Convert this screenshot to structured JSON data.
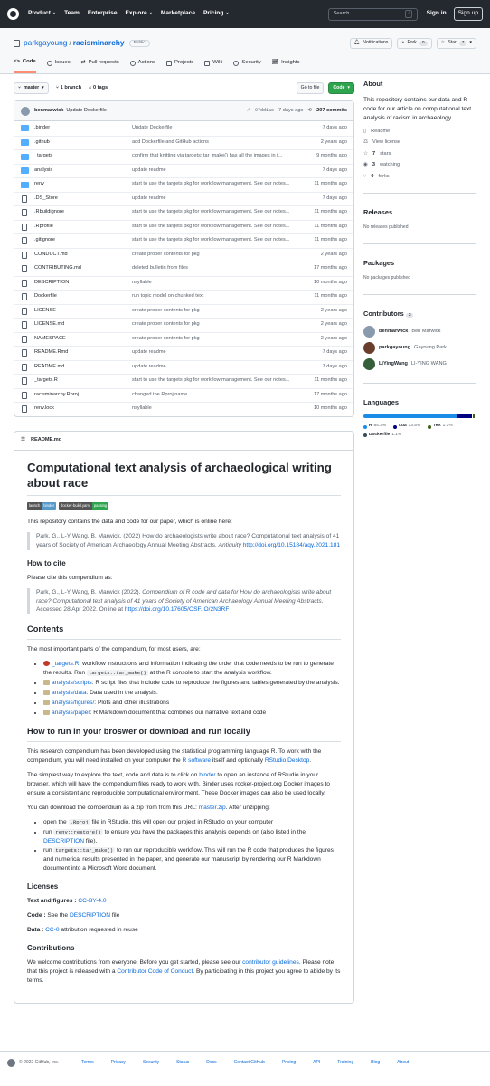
{
  "header": {
    "nav": [
      "Product",
      "Team",
      "Enterprise",
      "Explore",
      "Marketplace",
      "Pricing"
    ],
    "search_placeholder": "Search",
    "search_key": "/",
    "signin": "Sign in",
    "signup": "Sign up"
  },
  "repo": {
    "owner": "parkgayoung",
    "name": "racisminarchy",
    "visibility": "Public",
    "notifications": "Notifications",
    "fork": "Fork",
    "fork_count": "0",
    "star": "Star",
    "star_count": "7"
  },
  "tabs": [
    "Code",
    "Issues",
    "Pull requests",
    "Actions",
    "Projects",
    "Wiki",
    "Security",
    "Insights"
  ],
  "toolbar": {
    "branch": "master",
    "branches": "1 branch",
    "tags": "0 tags",
    "goto": "Go to file",
    "code": "Code"
  },
  "commit": {
    "user": "benmarwick",
    "message": "Update Dockerfile",
    "sha": "97dd1ae",
    "time": "7 days ago",
    "count": "207 commits"
  },
  "files": [
    {
      "type": "dir",
      "name": ".binder",
      "msg": "Update Dockerfile",
      "time": "7 days ago"
    },
    {
      "type": "dir",
      "name": ".github",
      "msg": "add Dockerfile and GitHub actions",
      "time": "2 years ago"
    },
    {
      "type": "dir",
      "name": "_targets",
      "msg": "confirm that knitting via targets::tar_make() has all the images in t...",
      "time": "9 months ago"
    },
    {
      "type": "dir",
      "name": "analysis",
      "msg": "update readme",
      "time": "7 days ago"
    },
    {
      "type": "dir",
      "name": "renv",
      "msg": "start to use the targets pkg for workflow management. See our notes...",
      "time": "11 months ago"
    },
    {
      "type": "file",
      "name": ".DS_Store",
      "msg": "update readme",
      "time": "7 days ago"
    },
    {
      "type": "file",
      "name": ".Rbuildignore",
      "msg": "start to use the targets pkg for workflow management. See our notes...",
      "time": "11 months ago"
    },
    {
      "type": "file",
      "name": ".Rprofile",
      "msg": "start to use the targets pkg for workflow management. See our notes...",
      "time": "11 months ago"
    },
    {
      "type": "file",
      "name": ".gitignore",
      "msg": "start to use the targets pkg for workflow management. See our notes...",
      "time": "11 months ago"
    },
    {
      "type": "file",
      "name": "CONDUCT.md",
      "msg": "create proper contents for pkg",
      "time": "2 years ago"
    },
    {
      "type": "file",
      "name": "CONTRIBUTING.md",
      "msg": "deleted bulletin from files",
      "time": "17 months ago"
    },
    {
      "type": "file",
      "name": "DESCRIPTION",
      "msg": "nsyllable",
      "time": "10 months ago"
    },
    {
      "type": "file",
      "name": "Dockerfile",
      "msg": "run topic model on chunked text",
      "time": "11 months ago"
    },
    {
      "type": "file",
      "name": "LICENSE",
      "msg": "create proper contents for pkg",
      "time": "2 years ago"
    },
    {
      "type": "file",
      "name": "LICENSE.md",
      "msg": "create proper contents for pkg",
      "time": "2 years ago"
    },
    {
      "type": "file",
      "name": "NAMESPACE",
      "msg": "create proper contents for pkg",
      "time": "2 years ago"
    },
    {
      "type": "file",
      "name": "README.Rmd",
      "msg": "update readme",
      "time": "7 days ago"
    },
    {
      "type": "file",
      "name": "README.md",
      "msg": "update readme",
      "time": "7 days ago"
    },
    {
      "type": "file",
      "name": "_targets.R",
      "msg": "start to use the targets pkg for workflow management. See our notes...",
      "time": "11 months ago"
    },
    {
      "type": "file",
      "name": "racisminarchy.Rproj",
      "msg": "changed the Rproj name",
      "time": "17 months ago"
    },
    {
      "type": "file",
      "name": "renv.lock",
      "msg": "nsyllable",
      "time": "10 months ago"
    }
  ],
  "readme": {
    "label": "README.md",
    "title": "Computational text analysis of archaeological writing about race",
    "badges": [
      {
        "left": "launch",
        "right": "binder",
        "color": "#579aca"
      },
      {
        "left": "docker-build.yaml",
        "right": "passing",
        "color": "#2ea44f"
      }
    ],
    "intro": "This repository contains the data and code for our paper, which is online here:",
    "quote1": "Park, G., L-Y Wang, B. Marwick, (2022) How do archaeologists write about race? Computational text analysis of 41 years of Society of American Archaeology Annual Meeting Abstracts.",
    "quote1_journal": "Antiquity",
    "quote1_link": "http://doi.org/10.15184/aqy.2021.181",
    "h_cite": "How to cite",
    "cite_intro": "Please cite this compendium as:",
    "quote2_a": "Park, G., L-Y Wang, B. Marwick (2022).",
    "quote2_b": "Compendium of R code and data for How do archaeologists write about race? Computational text analysis of 41 years of Society of American Archaeology Annual Meeting Abstracts",
    "quote2_c": ". Accessed 28 Apr 2022. Online at",
    "quote2_link": "https://doi.org/10.17605/OSF.IO/2N3RF",
    "h_contents": "Contents",
    "contents_intro": "The most important parts of the compendium, for most users, are:",
    "c1_link": "_targets.R",
    "c1_text": ": workflow instructions and information indicating the order that code needs to be run to generate the results. Run",
    "c1_code": "targets::tar_make()",
    "c1_tail": "at the R console to start the analysis workflow.",
    "c2_link": "analysis/scripts",
    "c2_text": ": R script files that include code to reproduce the figures and tables generated by the analysis.",
    "c3_link": "analysis/data",
    "c3_text": ": Data used in the analysis.",
    "c4_link": "analysis/figures/",
    "c4_text": ": Plots and other illustrations",
    "c5_link": "analysis/paper",
    "c5_text": ": R Markdown document that combines our narrative text and code",
    "h_run": "How to run in your broswer or download and run locally",
    "run1_a": "This research compendium has been developed using the statistical programming language R. To work with the compendium, you will need installed on your computer the",
    "run1_link1": "R software",
    "run1_b": "itself and optionally",
    "run1_link2": "RStudio Desktop",
    "run1_c": ".",
    "run2_a": "The simplest way to explore the text, code and data is to click on",
    "run2_link": "binder",
    "run2_b": "to open an instance of RStudio in your browser, which will have the compendium files ready to work with. Binder uses rocker-project.org Docker images to ensure a consistent and reproducible computational environment. These Docker images can also be used locally.",
    "run3_a": "You can download the compendium as a zip from from this URL:",
    "run3_link": "master.zip",
    "run3_b": ". After unzipping:",
    "s1_a": "open the",
    "s1_code": ".Rproj",
    "s1_b": "file in RStudio, this will open our project in RStudio on your computer",
    "s2_a": "run",
    "s2_code": "renv::restore()",
    "s2_b": "to ensure you have the packages this analysis depends on (also listed in the",
    "s2_link": "DESCRIPTION",
    "s2_c": "file).",
    "s3_a": "run",
    "s3_code": "targets::tar_make()",
    "s3_b": "to run our reproducible workflow. This will run the R code that produces the figures and numerical results presented in the paper, and generate our manuscript by rendering our R Markdown document into a Microsoft Word document.",
    "h_lic": "Licenses",
    "lic1_label": "Text and figures :",
    "lic1_link": "CC-BY-4.0",
    "lic2_label": "Code :",
    "lic2_a": "See the",
    "lic2_link": "DESCRIPTION",
    "lic2_b": "file",
    "lic3_label": "Data :",
    "lic3_link": "CC-0",
    "lic3_b": "attribution requested in reuse",
    "h_contrib": "Contributions",
    "contrib_a": "We welcome contributions from everyone. Before you get started, please see our",
    "contrib_link1": "contributor guidelines",
    "contrib_b": ". Please note that this project is released with a",
    "contrib_link2": "Contributor Code of Conduct",
    "contrib_c": ". By participating in this project you agree to abide by its terms."
  },
  "sidebar": {
    "about_title": "About",
    "about_text": "This repository contains our data and R code for our article on computational text analysis of racism in archaeology.",
    "readme": "Readme",
    "license": "View license",
    "stars": "7",
    "stars_label": "stars",
    "watching": "3",
    "watching_label": "watching",
    "forks": "0",
    "forks_label": "forks",
    "releases_title": "Releases",
    "releases_text": "No releases published",
    "packages_title": "Packages",
    "packages_text": "No packages published",
    "contributors_title": "Contributors",
    "contributors_count": "3",
    "contributors": [
      {
        "login": "benmarwick",
        "name": "Ben Marwick",
        "color": "#8a9aad"
      },
      {
        "login": "parkgayoung",
        "name": "Gayoung Park",
        "color": "#6b3e2b"
      },
      {
        "login": "LiYingWang",
        "name": "LI-YING WANG",
        "color": "#355e3b"
      }
    ],
    "languages_title": "Languages",
    "languages": [
      {
        "name": "R",
        "pct": "84.3%",
        "value": 84.3,
        "color": "#198ce7"
      },
      {
        "name": "Lua",
        "pct": "13.5%",
        "value": 13.5,
        "color": "#000080"
      },
      {
        "name": "TeX",
        "pct": "1.1%",
        "value": 1.1,
        "color": "#3d6117"
      },
      {
        "name": "Dockerfile",
        "pct": "1.1%",
        "value": 1.1,
        "color": "#384d54"
      }
    ]
  },
  "footer": {
    "copyright": "© 2022 GitHub, Inc.",
    "links": [
      "Terms",
      "Privacy",
      "Security",
      "Status",
      "Docs",
      "Contact GitHub",
      "Pricing",
      "API",
      "Training",
      "Blog",
      "About"
    ]
  }
}
